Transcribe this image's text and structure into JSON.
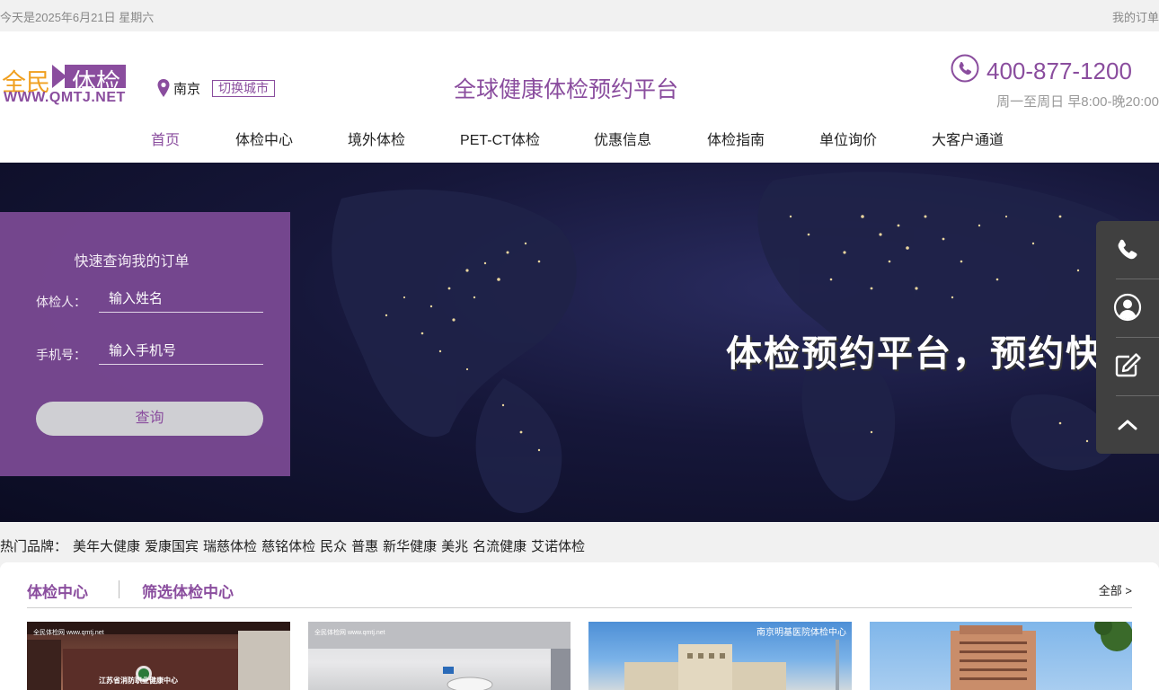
{
  "topbar": {
    "date": "今天是2025年6月21日 星期六",
    "my_orders": "我的订单"
  },
  "logo": {
    "part1": "全民",
    "part2": "体检",
    "url": "WWW.QMTJ.NET"
  },
  "location": {
    "city": "南京",
    "switch_label": "切换城市"
  },
  "slogan": "全球健康体检预约平台",
  "contact": {
    "phone": "400-877-1200",
    "hours": "周一至周日 早8:00-晚20:00"
  },
  "nav": [
    {
      "label": "首页",
      "active": true
    },
    {
      "label": "体检中心"
    },
    {
      "label": "境外体检"
    },
    {
      "label": "PET-CT体检"
    },
    {
      "label": "优惠信息"
    },
    {
      "label": "体检指南"
    },
    {
      "label": "单位询价"
    },
    {
      "label": "大客户通道"
    }
  ],
  "banner": {
    "headline": "体检预约平台，预约快"
  },
  "order_query": {
    "title": "快速查询我的订单",
    "name_label": "体检人：",
    "name_placeholder": "输入姓名",
    "phone_label": "手机号：",
    "phone_placeholder": "输入手机号",
    "submit_label": "查询"
  },
  "sidebar": {
    "icons": [
      "phone-icon",
      "user-icon",
      "edit-icon",
      "chevron-up-icon"
    ]
  },
  "hot_brands": {
    "label": "热门品牌：",
    "items": [
      "美年大健康",
      "爱康国宾",
      "瑞慈体检",
      "慈铭体检",
      "民众",
      "普惠",
      "新华健康",
      "美兆",
      "名流健康",
      "艾诺体检"
    ]
  },
  "centers": {
    "title": "体检中心",
    "filter_label": "筛选体检中心",
    "all_label": "全部 >",
    "cards": [
      {
        "watermark": "全民体检网 www.qmtj.net",
        "sign": "江苏省消防职业健康中心"
      },
      {
        "watermark": "全民体检网 www.qmtj.net"
      },
      {
        "caption": "南京明基医院体检中心"
      },
      {}
    ]
  },
  "colors": {
    "brand_purple": "#8a4d9e",
    "logo_orange": "#f0a020",
    "sidebar_bg": "#404040"
  }
}
